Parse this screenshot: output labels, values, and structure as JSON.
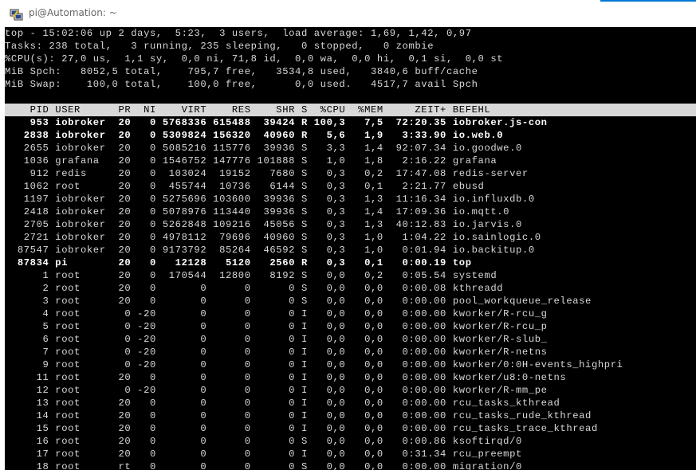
{
  "window": {
    "title": "pi@Automation: ~",
    "icon": "putty-icon"
  },
  "summary": [
    "top - 15:02:06 up 2 days,  5:23,  3 users,  load average: 1,69, 1,42, 0,97",
    "Tasks: 238 total,   3 running, 235 sleeping,   0 stopped,   0 zombie",
    "%CPU(s): 27,0 us,  1,1 sy,  0,0 ni, 71,8 id,  0,0 wa,  0,0 hi,  0,1 si,  0,0 st",
    "MiB Spch:   8052,5 total,    795,7 free,   3534,8 used,   3840,6 buff/cache",
    "MiB Swap:    100,0 total,    100,0 free,      0,0 used.   4517,7 avail Spch"
  ],
  "columns": "    PID USER      PR  NI    VIRT    RES    SHR S  %CPU  %MEM     ZEIT+ BEFEHL",
  "processes": [
    {
      "line": "    953 iobroker  20   0 5768336 615488  39424 R 100,3   7,5  72:20.35 iobroker.js-con",
      "bold": true
    },
    {
      "line": "   2838 iobroker  20   0 5309824 156320  40960 R   5,6   1,9   3:33.90 io.web.0",
      "bold": true
    },
    {
      "line": "   2655 iobroker  20   0 5085216 115776  39936 S   3,3   1,4  92:07.34 io.goodwe.0",
      "bold": false
    },
    {
      "line": "   1036 grafana   20   0 1546752 147776 101888 S   1,0   1,8   2:16.22 grafana",
      "bold": false
    },
    {
      "line": "    912 redis     20   0  103024  19152   7680 S   0,3   0,2  17:47.08 redis-server",
      "bold": false
    },
    {
      "line": "   1062 root      20   0  455744  10736   6144 S   0,3   0,1   2:21.77 ebusd",
      "bold": false
    },
    {
      "line": "   1197 iobroker  20   0 5275696 103600  39936 S   0,3   1,3  11:16.34 io.influxdb.0",
      "bold": false
    },
    {
      "line": "   2418 iobroker  20   0 5078976 113440  39936 S   0,3   1,4  17:09.36 io.mqtt.0",
      "bold": false
    },
    {
      "line": "   2705 iobroker  20   0 5262848 109216  45056 S   0,3   1,3  40:12.83 io.jarvis.0",
      "bold": false
    },
    {
      "line": "   2721 iobroker  20   0 4978112  79696  40960 S   0,3   1,0   1:04.22 io.sainlogic.0",
      "bold": false
    },
    {
      "line": "  87547 iobroker  20   0 9173792  85264  46592 S   0,3   1,0   0:01.94 io.backitup.0",
      "bold": false
    },
    {
      "line": "  87834 pi        20   0   12128   5120   2560 R   0,3   0,1   0:00.19 top",
      "bold": true
    },
    {
      "line": "      1 root      20   0  170544  12800   8192 S   0,0   0,2   0:05.54 systemd",
      "bold": false
    },
    {
      "line": "      2 root      20   0       0      0      0 S   0,0   0,0   0:00.08 kthreadd",
      "bold": false
    },
    {
      "line": "      3 root      20   0       0      0      0 S   0,0   0,0   0:00.00 pool_workqueue_release",
      "bold": false
    },
    {
      "line": "      4 root       0 -20       0      0      0 I   0,0   0,0   0:00.00 kworker/R-rcu_g",
      "bold": false
    },
    {
      "line": "      5 root       0 -20       0      0      0 I   0,0   0,0   0:00.00 kworker/R-rcu_p",
      "bold": false
    },
    {
      "line": "      6 root       0 -20       0      0      0 I   0,0   0,0   0:00.00 kworker/R-slub_",
      "bold": false
    },
    {
      "line": "      7 root       0 -20       0      0      0 I   0,0   0,0   0:00.00 kworker/R-netns",
      "bold": false
    },
    {
      "line": "      9 root       0 -20       0      0      0 I   0,0   0,0   0:00.00 kworker/0:0H-events_highpri",
      "bold": false
    },
    {
      "line": "     11 root      20   0       0      0      0 I   0,0   0,0   0:00.00 kworker/u8:0-netns",
      "bold": false
    },
    {
      "line": "     12 root       0 -20       0      0      0 I   0,0   0,0   0:00.00 kworker/R-mm_pe",
      "bold": false
    },
    {
      "line": "     13 root      20   0       0      0      0 I   0,0   0,0   0:00.00 rcu_tasks_kthread",
      "bold": false
    },
    {
      "line": "     14 root      20   0       0      0      0 I   0,0   0,0   0:00.00 rcu_tasks_rude_kthread",
      "bold": false
    },
    {
      "line": "     15 root      20   0       0      0      0 I   0,0   0,0   0:00.00 rcu_tasks_trace_kthread",
      "bold": false
    },
    {
      "line": "     16 root      20   0       0      0      0 S   0,0   0,0   0:00.86 ksoftirqd/0",
      "bold": false
    },
    {
      "line": "     17 root      20   0       0      0      0 I   0,0   0,0   0:31.34 rcu_preempt",
      "bold": false
    },
    {
      "line": "     18 root      rt   0       0      0      0 S   0,0   0,0   0:00.00 migration/0",
      "bold": false
    }
  ],
  "colors": {
    "terminal_bg": "#000000",
    "terminal_fg": "#d8d8d8",
    "header_bg": "#d8d8d8",
    "accent": "#0078d4"
  }
}
